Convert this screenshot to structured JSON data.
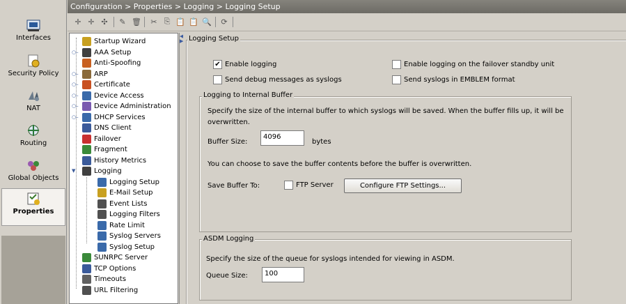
{
  "left_nav": {
    "items": [
      {
        "label": "Interfaces",
        "icon": "network-card-icon",
        "color": "#2a5a9a"
      },
      {
        "label": "Security Policy",
        "icon": "security-policy-icon",
        "color": "#c8a020"
      },
      {
        "label": "NAT",
        "icon": "nat-icon",
        "color": "#507090"
      },
      {
        "label": "Routing",
        "icon": "routing-icon",
        "color": "#3a7a4a"
      },
      {
        "label": "Global Objects",
        "icon": "global-objects-icon",
        "color": "#9a5ab0"
      },
      {
        "label": "Properties",
        "icon": "properties-icon",
        "color": "#6a8a4a"
      }
    ],
    "active_item": "Properties"
  },
  "breadcrumb": "Configuration > Properties > Logging > Logging Setup",
  "toolbar": {
    "icons": [
      "add-icon",
      "add-alt-icon",
      "insert-icon",
      "edit-icon",
      "delete-icon",
      "cut-icon",
      "copy-icon",
      "paste-icon",
      "paste-alt-icon",
      "find-icon",
      "refresh-icon"
    ]
  },
  "tree": {
    "items": [
      {
        "label": "Startup Wizard",
        "icon": "wizard-icon",
        "color": "#c8a020",
        "level": 0,
        "expander": false
      },
      {
        "label": "AAA Setup",
        "icon": "aaa-icon",
        "color": "#404040",
        "level": 0,
        "expander": true
      },
      {
        "label": "Anti-Spoofing",
        "icon": "anti-spoofing-icon",
        "color": "#c86020",
        "level": 0,
        "expander": false
      },
      {
        "label": "ARP",
        "icon": "arp-icon",
        "color": "#8a6a3a",
        "level": 0,
        "expander": true
      },
      {
        "label": "Certificate",
        "icon": "certificate-icon",
        "color": "#c85020",
        "level": 0,
        "expander": true
      },
      {
        "label": "Device Access",
        "icon": "device-access-icon",
        "color": "#3a6aaa",
        "level": 0,
        "expander": true
      },
      {
        "label": "Device Administration",
        "icon": "device-admin-icon",
        "color": "#7a5ab0",
        "level": 0,
        "expander": true
      },
      {
        "label": "DHCP Services",
        "icon": "dhcp-icon",
        "color": "#3a6aaa",
        "level": 0,
        "expander": true
      },
      {
        "label": "DNS Client",
        "icon": "dns-icon",
        "color": "#3a5a9a",
        "level": 0,
        "expander": false
      },
      {
        "label": "Failover",
        "icon": "failover-icon",
        "color": "#c83030",
        "level": 0,
        "expander": false
      },
      {
        "label": "Fragment",
        "icon": "fragment-icon",
        "color": "#3a8a3a",
        "level": 0,
        "expander": false
      },
      {
        "label": "History Metrics",
        "icon": "history-metrics-icon",
        "color": "#3a5a9a",
        "level": 0,
        "expander": false
      },
      {
        "label": "Logging",
        "icon": "logging-icon",
        "color": "#404040",
        "level": 0,
        "expander": true,
        "expanded": true
      },
      {
        "label": "Logging Setup",
        "icon": "logging-setup-icon",
        "color": "#3a6aaa",
        "level": 1,
        "expander": false
      },
      {
        "label": "E-Mail Setup",
        "icon": "email-setup-icon",
        "color": "#c8a020",
        "level": 1,
        "expander": false
      },
      {
        "label": "Event Lists",
        "icon": "event-lists-icon",
        "color": "#505050",
        "level": 1,
        "expander": false
      },
      {
        "label": "Logging Filters",
        "icon": "logging-filters-icon",
        "color": "#505050",
        "level": 1,
        "expander": false
      },
      {
        "label": "Rate Limit",
        "icon": "rate-limit-icon",
        "color": "#3a6aaa",
        "level": 1,
        "expander": false
      },
      {
        "label": "Syslog Servers",
        "icon": "syslog-servers-icon",
        "color": "#3a6aaa",
        "level": 1,
        "expander": false
      },
      {
        "label": "Syslog Setup",
        "icon": "syslog-setup-icon",
        "color": "#3a6aaa",
        "level": 1,
        "expander": false
      },
      {
        "label": "SUNRPC Server",
        "icon": "sunrpc-icon",
        "color": "#3a8a3a",
        "level": 0,
        "expander": false
      },
      {
        "label": "TCP Options",
        "icon": "tcp-options-icon",
        "color": "#3a5a9a",
        "level": 0,
        "expander": false
      },
      {
        "label": "Timeouts",
        "icon": "timeouts-icon",
        "color": "#606060",
        "level": 0,
        "expander": false
      },
      {
        "label": "URL Filtering",
        "icon": "url-filtering-icon",
        "color": "#505050",
        "level": 0,
        "expander": false
      }
    ],
    "selected": "Logging Setup"
  },
  "content": {
    "main_title": "Logging Setup",
    "enable_logging": {
      "label": "Enable logging",
      "checked": true
    },
    "enable_failover": {
      "label": "Enable logging on the failover standby unit",
      "checked": false
    },
    "send_debug": {
      "label": "Send debug messages as syslogs",
      "checked": false
    },
    "send_emblem": {
      "label": "Send syslogs in EMBLEM format",
      "checked": false
    },
    "buffer_group": {
      "title": "Logging to Internal Buffer",
      "description": "Specify the size of the internal buffer to which syslogs will be saved. When the buffer fills up, it will be",
      "description2": "overwritten.",
      "size_label": "Buffer Size:",
      "size_value": "4096",
      "size_unit": "bytes",
      "save_note": "You can choose to save the buffer contents before the buffer is overwritten.",
      "save_label": "Save Buffer To:",
      "ftp_checkbox": {
        "label": "FTP Server",
        "checked": false
      },
      "configure_button": "Configure FTP Settings..."
    },
    "asdm_group": {
      "title": "ASDM Logging",
      "description": "Specify the size of the queue for syslogs intended for viewing in ASDM.",
      "queue_label": "Queue Size:",
      "queue_value": "100"
    }
  }
}
